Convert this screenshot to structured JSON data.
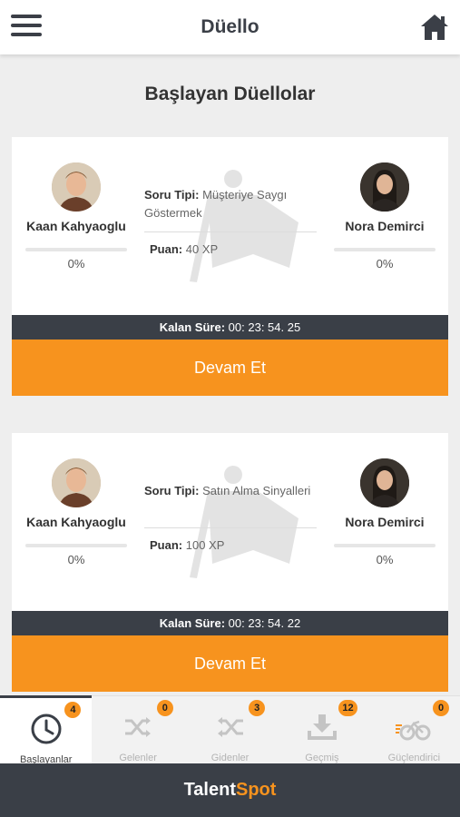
{
  "header": {
    "title": "Düello",
    "menu_icon": "menu-icon",
    "home_icon": "home-icon"
  },
  "section_title": "Başlayan Düellolar",
  "duels": [
    {
      "left_player": {
        "name": "Kaan Kahyaoglu",
        "progress": "0%"
      },
      "right_player": {
        "name": "Nora Demirci",
        "progress": "0%"
      },
      "question_label": "Soru Tipi:",
      "question_value": "Müşteriye Saygı Göstermek",
      "points_label": "Puan:",
      "points_value": "40 XP",
      "timer_label": "Kalan Süre:",
      "timer_value": "00: 23: 54. 25",
      "button_label": "Devam Et"
    },
    {
      "left_player": {
        "name": "Kaan Kahyaoglu",
        "progress": "0%"
      },
      "right_player": {
        "name": "Nora Demirci",
        "progress": "0%"
      },
      "question_label": "Soru Tipi:",
      "question_value": "Satın Alma Sinyalleri",
      "points_label": "Puan:",
      "points_value": "100 XP",
      "timer_label": "Kalan Süre:",
      "timer_value": "00: 23: 54. 22",
      "button_label": "Devam Et"
    }
  ],
  "bottom_nav": [
    {
      "label": "Başlayanlar",
      "badge": "4",
      "icon": "clock-icon",
      "active": true
    },
    {
      "label": "Gelenler",
      "badge": "0",
      "icon": "shuffle-icon",
      "active": false
    },
    {
      "label": "Gidenler",
      "badge": "3",
      "icon": "shuffle-reverse-icon",
      "active": false
    },
    {
      "label": "Geçmiş",
      "badge": "12",
      "icon": "download-tray-icon",
      "active": false
    },
    {
      "label": "Güçlendirici",
      "badge": "0",
      "icon": "speed-bike-icon",
      "active": false
    }
  ],
  "footer": {
    "brand_part1": "Talent",
    "brand_part2": "Spot"
  },
  "colors": {
    "accent": "#f7931e",
    "dark": "#3a3f47",
    "background": "#eeeeee"
  }
}
